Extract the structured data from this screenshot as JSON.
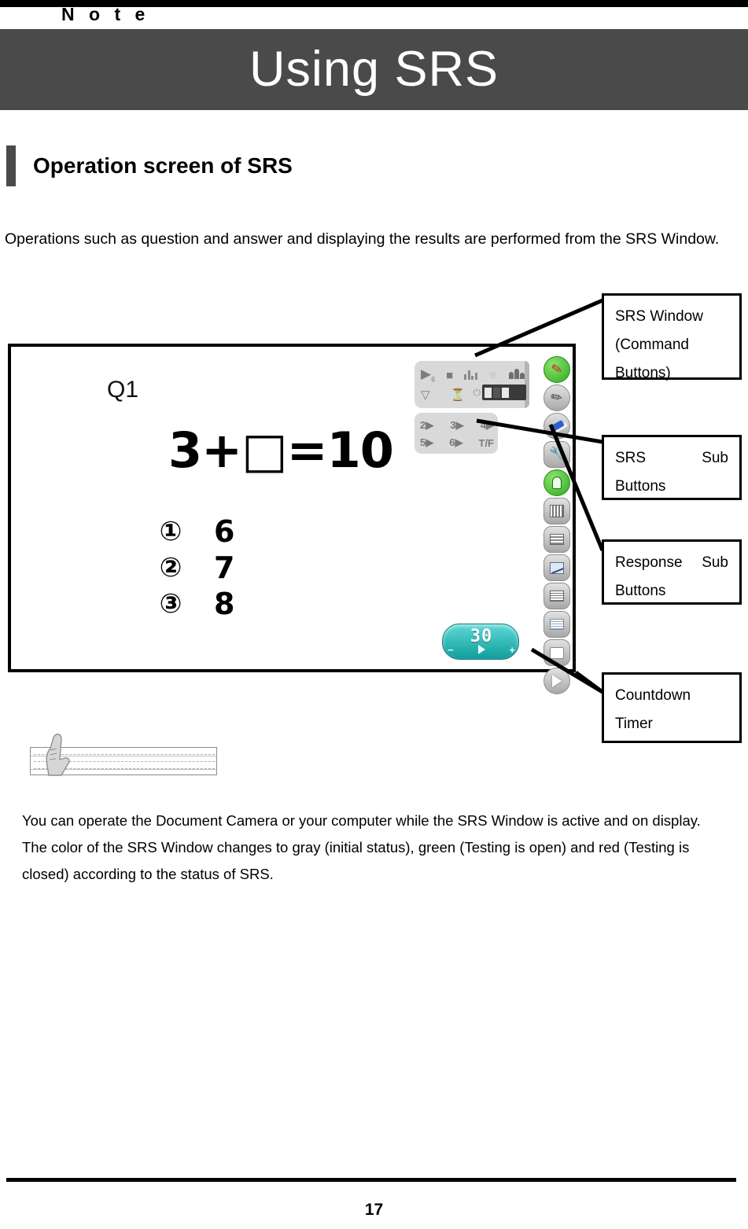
{
  "banner": {
    "title": "Using SRS"
  },
  "section": {
    "title": "Operation screen of SRS"
  },
  "intro": {
    "text": "Operations such as question and answer and displaying the results are performed from the SRS Window."
  },
  "screenshot": {
    "question_label": "Q1",
    "equation": "3+□=10",
    "choices": [
      {
        "marker": "①",
        "value": "6"
      },
      {
        "marker": "②",
        "value": "7"
      },
      {
        "marker": "③",
        "value": "8"
      }
    ],
    "command_panel": {
      "row1": [
        "play-6-icon",
        "stop-icon",
        "bar-chart-icon",
        "sparkle-icon",
        "people-icon"
      ],
      "play_label": "6",
      "row2": [
        "collapse-triangle-icon",
        "stopwatch-icon"
      ],
      "lcd_label": ""
    },
    "sub_buttons": {
      "row1": [
        "2▶",
        "3▶",
        "4▶"
      ],
      "row2": [
        "5▶",
        "6▶",
        "T/F"
      ]
    },
    "toolbar_icons": [
      "color-pencil-icon",
      "pencil-icon",
      "eraser-icon",
      "tools-wrench-icon",
      "spotlight-lamp-icon",
      "blinds-icon",
      "lined-paper-icon",
      "graph-paper-icon",
      "music-staff-icon",
      "notebook-lines-icon",
      "blank-page-icon",
      "expand-arrow-icon"
    ],
    "timer": {
      "value": "30",
      "minus": "−",
      "plus": "+"
    }
  },
  "callouts": [
    {
      "id": "srs-window",
      "lines": [
        "SRS Window",
        "(Command",
        "Buttons)"
      ]
    },
    {
      "id": "srs-sub-buttons",
      "line1_left": "SRS",
      "line1_right": "Sub",
      "line2": "Buttons"
    },
    {
      "id": "response-sub-buttons",
      "line1_left": "Response",
      "line1_right": "Sub",
      "line2": "Buttons"
    },
    {
      "id": "countdown-timer",
      "lines": [
        "Countdown",
        "Timer"
      ]
    }
  ],
  "note": {
    "label": "N o t e",
    "paragraphs": [
      "You can operate the Document Camera or your computer while the SRS Window is active and on display.",
      "The color of the SRS Window changes to gray (initial status), green (Testing is open) and red (Testing is closed) according to the status of SRS."
    ]
  },
  "footer": {
    "page_number": "17"
  },
  "colors": {
    "banner_bg": "#4a4a4a",
    "accent_bar": "#4a4a4a",
    "timer_teal": "#17b0ae",
    "toolbar_green": "#2faa22",
    "panel_gray": "#d9d9d9"
  }
}
